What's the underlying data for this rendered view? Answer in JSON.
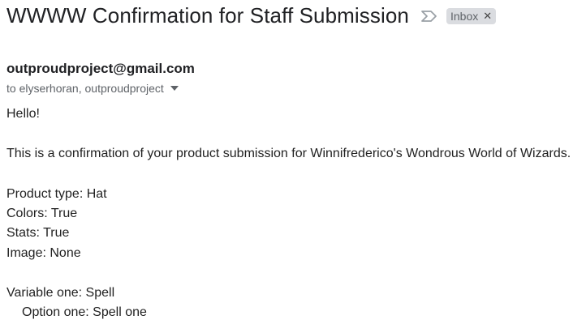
{
  "email": {
    "subject": "WWWW Confirmation for Staff Submission",
    "label": "Inbox",
    "important_icon": "important-marker-icon",
    "sender": "outproudproject@gmail.com",
    "recipients": "to elyserhoran, outproudproject",
    "body": {
      "greeting": "Hello!",
      "intro": "This is a confirmation of your product submission for Winnifrederico's Wondrous World of Wizards.",
      "fields": [
        "Product type: Hat",
        "Colors: True",
        "Stats: True",
        "Image: None"
      ],
      "variable": "Variable one: Spell",
      "option": "Option one: Spell one"
    }
  }
}
